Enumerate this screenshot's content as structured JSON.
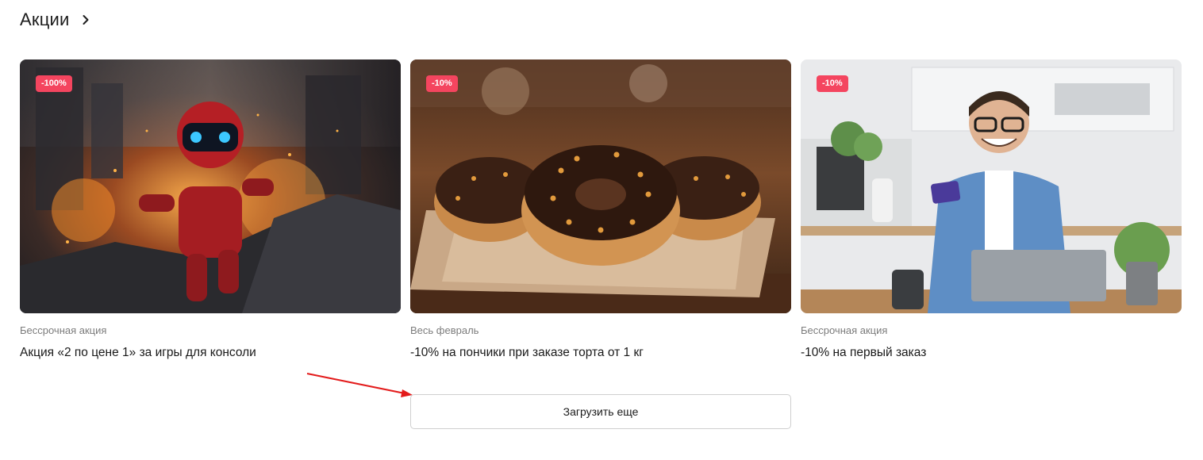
{
  "section": {
    "title": "Акции",
    "chevron_icon": "chevron-right-icon"
  },
  "colors": {
    "badge": "#f4455f",
    "annotation_arrow": "#e31b1b",
    "button_border": "#cfcfcf"
  },
  "cards": [
    {
      "badge": "-100%",
      "meta": "Бессрочная акция",
      "title": "Акция «2 по цене 1» за игры для консоли",
      "image": "robot-in-explosion-image"
    },
    {
      "badge": "-10%",
      "meta": "Весь февраль",
      "title": "-10% на пончики при заказе торта от 1 кг",
      "image": "chocolate-donuts-image"
    },
    {
      "badge": "-10%",
      "meta": "Бессрочная акция",
      "title": "-10% на первый заказ",
      "image": "man-with-card-and-laptop-image"
    }
  ],
  "load_more": {
    "label": "Загрузить еще"
  }
}
